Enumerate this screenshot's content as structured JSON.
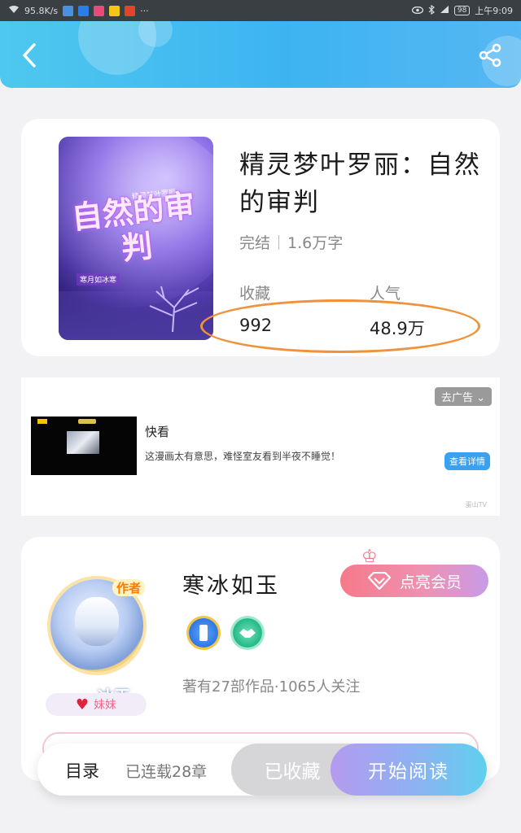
{
  "status_bar": {
    "net_speed": "95.8K/s",
    "dots": "···",
    "battery": "98",
    "time": "上午9:09"
  },
  "book": {
    "cover": {
      "subtitle": "精灵梦叶罗丽",
      "title": "自然的审判",
      "author": "寒月如冰寒"
    },
    "title": "精灵梦叶罗丽：自然的审判",
    "status": "完结",
    "word_count": "1.6万字",
    "favorites_label": "收藏",
    "favorites_value": "992",
    "popularity_label": "人气",
    "popularity_value": "48.9万"
  },
  "ad": {
    "close_label": "去广告",
    "title": "快看",
    "description": "这漫画太有意思，难怪室友看到半夜不睡觉！",
    "detail_label": "查看详情",
    "mark": "蛋山TV"
  },
  "author": {
    "avatar_badge": "作者",
    "avatar_name": "冰玉",
    "tag": "妹妹",
    "name": "寒冰如玉",
    "vip_label": "点亮会员",
    "stats": "著有27部作品·1065人关注"
  },
  "bottom_bar": {
    "toc_label": "目录",
    "chapters_label": "已连载28章",
    "collected_label": "已收藏",
    "read_label": "开始阅读"
  },
  "colors": {
    "header_gradient_start": "#4fc8ef",
    "header_gradient_end": "#55b7f3",
    "highlight_ellipse": "#f0913b",
    "vip_button": "#f47a8a",
    "read_button_start": "#b59af0",
    "read_button_end": "#5fd0ee"
  }
}
